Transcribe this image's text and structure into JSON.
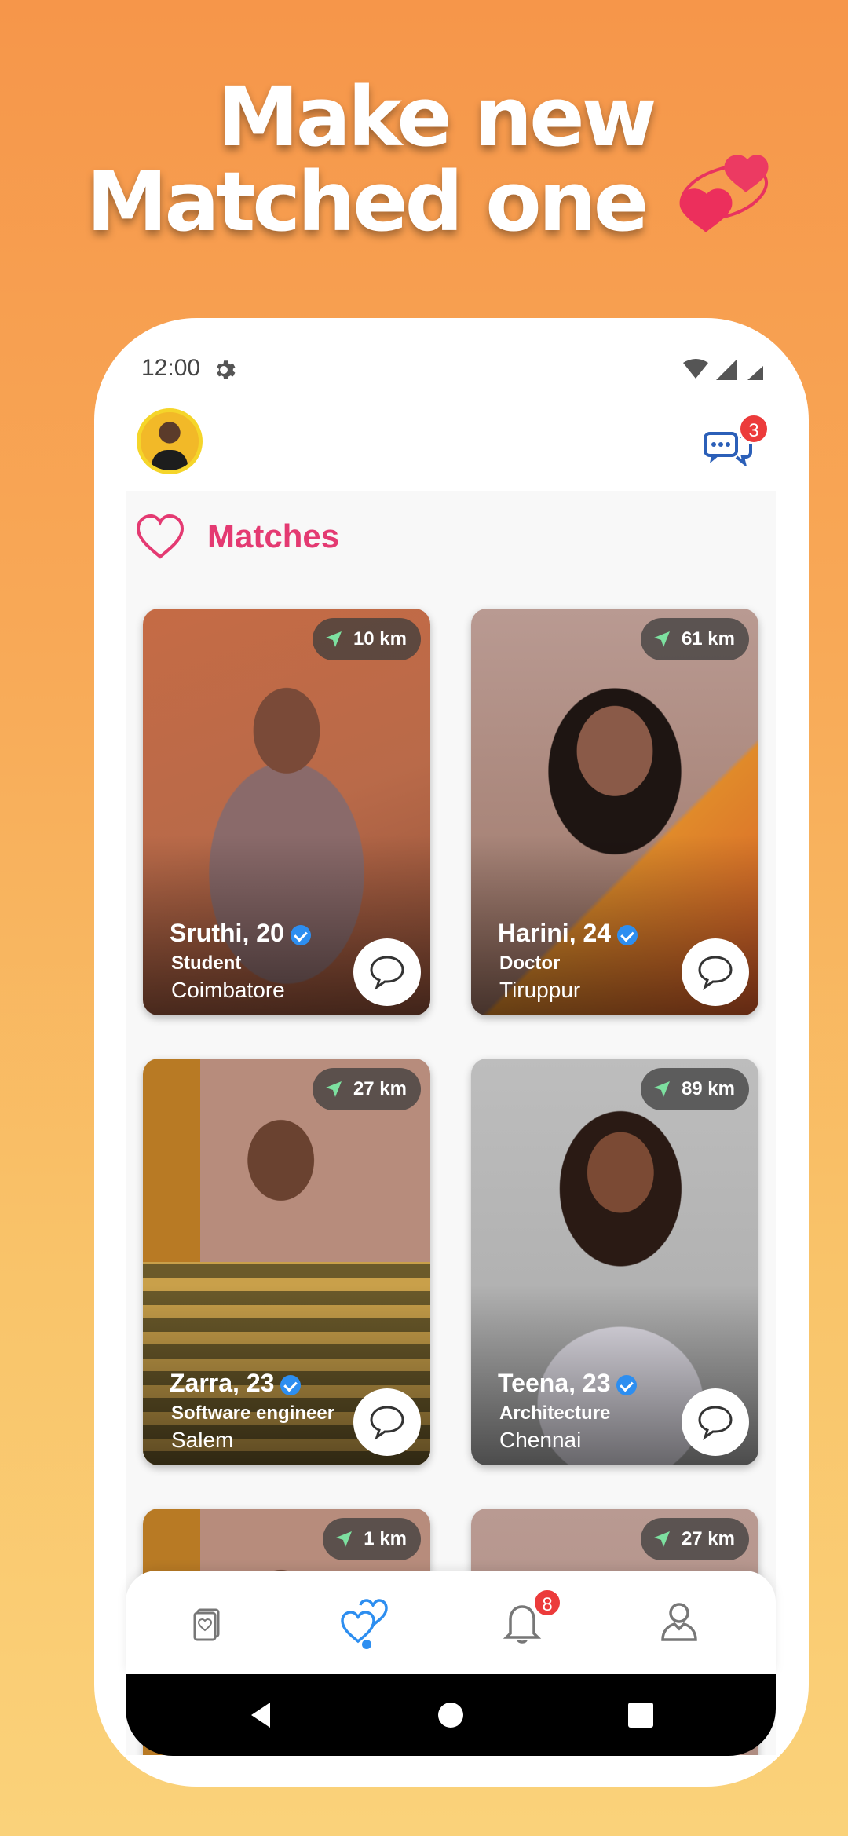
{
  "promo": {
    "line1": "Make new",
    "line2": "Matched one"
  },
  "status_bar": {
    "time": "12:00"
  },
  "header": {
    "chat_badge": "3"
  },
  "section": {
    "title": "Matches"
  },
  "cards": [
    {
      "name": "Sruthi, 20",
      "job": "Student",
      "city": "Coimbatore",
      "distance": "10 km"
    },
    {
      "name": "Harini, 24",
      "job": "Doctor",
      "city": "Tiruppur",
      "distance": "61 km"
    },
    {
      "name": "Zarra, 23",
      "job": "Software engineer",
      "city": "Salem",
      "distance": "27 km"
    },
    {
      "name": "Teena, 23",
      "job": "Architecture",
      "city": "Chennai",
      "distance": "89 km"
    },
    {
      "distance": "1 km"
    },
    {
      "distance": "27 km"
    }
  ],
  "bottom_nav": {
    "notification_badge": "8"
  },
  "colors": {
    "accent_pink": "#e43a72",
    "verify_blue": "#2d8ef0",
    "badge_red": "#ec3b3b"
  }
}
